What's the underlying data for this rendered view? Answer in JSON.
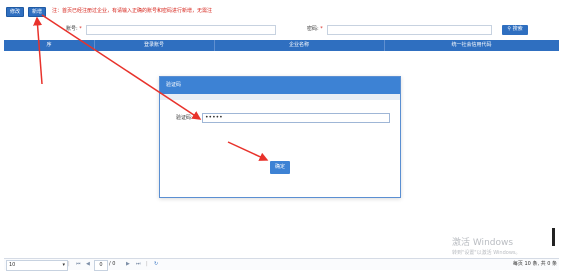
{
  "toolbar": {
    "add_label": "修改",
    "search_label": "新增",
    "warning": "注：首页已经注册过企业，有请输入正确的账号和密码进行新增，无需注",
    "account_label": "账号",
    "password_label": "密码",
    "required_mark": "*",
    "query_label": "搜索",
    "search_icon": "search-icon"
  },
  "grid": {
    "columns": [
      "序",
      "登录账号",
      "企业名称",
      "统一社会信用代码"
    ]
  },
  "dialog": {
    "title": "验证码",
    "field_label": "验证码:",
    "field_value": "•••••",
    "confirm_label": "确定"
  },
  "pager": {
    "page_size": "10",
    "page_input": "0",
    "page_total": "/ 0",
    "summary": "每页 10 条, 共 0 条",
    "first_icon": "first-page-icon",
    "prev_icon": "prev-page-icon",
    "next_icon": "next-page-icon",
    "last_icon": "last-page-icon",
    "refresh_icon": "refresh-icon"
  },
  "watermark": {
    "line1": "激活 Windows",
    "line2": "转到\"设置\"以激活 Windows。"
  },
  "colors": {
    "primary": "#2f6fc0",
    "dialog_header": "#3d82d4",
    "annotation": "#e8322b"
  }
}
